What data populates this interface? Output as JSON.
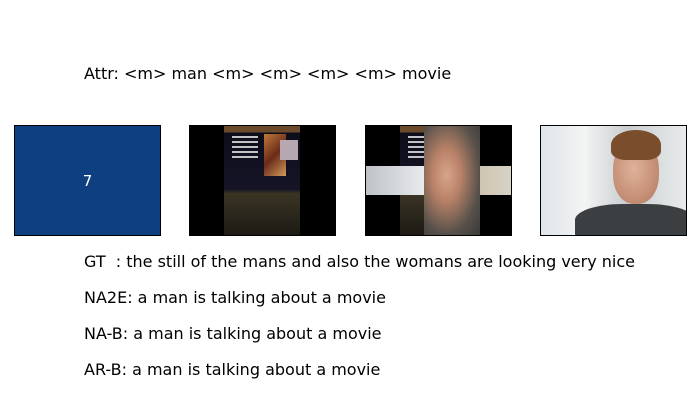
{
  "attr_line": "Attr: <m> man <m> <m> <m> <m> movie",
  "panels": [
    {
      "name": "attribute-frame",
      "label": "7",
      "color": "#0e3f80"
    },
    {
      "name": "movie-poster-frame"
    },
    {
      "name": "mixed-frame"
    },
    {
      "name": "man-talking-frame"
    }
  ],
  "captions": {
    "gt": "GT  : the still of the mans and also the womans are looking very nice",
    "na2e": "NA2E: a man is talking about a movie",
    "nab": "NA-B: a man is talking about a movie",
    "arb": "AR-B: a man is talking about a movie"
  }
}
